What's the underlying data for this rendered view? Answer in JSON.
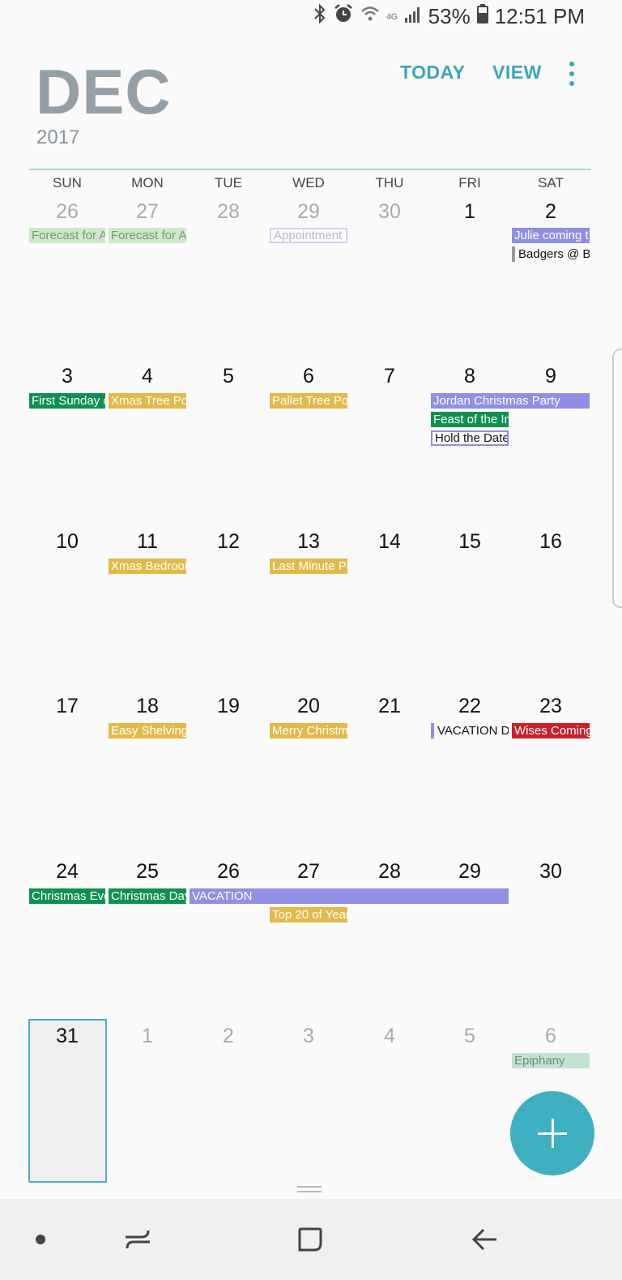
{
  "status_bar": {
    "network": "4G",
    "battery": "53%",
    "time": "12:51 PM"
  },
  "header": {
    "month": "DEC",
    "year": "2017",
    "today_label": "TODAY",
    "view_label": "VIEW"
  },
  "weekdays": [
    "SUN",
    "MON",
    "TUE",
    "WED",
    "THU",
    "FRI",
    "SAT"
  ],
  "weeks": [
    [
      "26",
      "27",
      "28",
      "29",
      "30",
      "1",
      "2"
    ],
    [
      "3",
      "4",
      "5",
      "6",
      "7",
      "8",
      "9"
    ],
    [
      "10",
      "11",
      "12",
      "13",
      "14",
      "15",
      "16"
    ],
    [
      "17",
      "18",
      "19",
      "20",
      "21",
      "22",
      "23"
    ],
    [
      "24",
      "25",
      "26",
      "27",
      "28",
      "29",
      "30"
    ],
    [
      "31",
      "1",
      "2",
      "3",
      "4",
      "5",
      "6"
    ]
  ],
  "events": {
    "w1_sun": "Forecast for A",
    "w1_mon": "Forecast for A",
    "w1_wed": "Appointment",
    "w1_sat_1": "Julie coming t",
    "w1_sat_2": "Badgers @ Bu",
    "w2_sun": "First Sunday o",
    "w2_mon": "Xmas Tree Pos",
    "w2_wed": "Pallet Tree Po",
    "w2_fri_sat": "Jordan Christmas Party",
    "w2_fri_2": "Feast of the In",
    "w2_fri_3": "Hold the Date",
    "w3_mon": "Xmas Bedroor",
    "w3_wed": "Last Minute Pr",
    "w4_mon": "Easy Shelving",
    "w4_wed": "Merry Christm",
    "w4_fri": "VACATION DA",
    "w4_sat": "Wises Coming",
    "w5_sun": "Christmas Eve",
    "w5_mon": "Christmas Day",
    "w5_vacation": "VACATION",
    "w5_wed_2": "Top 20 of Year",
    "w6_sat": "Epiphany"
  },
  "colors": {
    "accent": "#3aa6b9",
    "event_green": "#0e9150",
    "event_gold": "#e3b94a",
    "event_purple": "#8f8fe3",
    "event_red": "#c8202b"
  }
}
